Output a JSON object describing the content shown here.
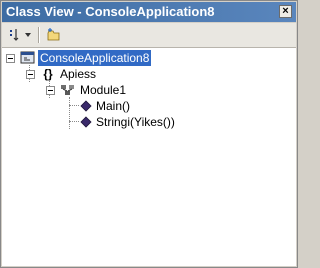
{
  "window": {
    "title": "Class View - ConsoleApplication8",
    "close_glyph": "×"
  },
  "toolbar": {
    "sort_button_icon": "sort-icon",
    "new_folder_icon": "new-folder-icon"
  },
  "tree": {
    "project": {
      "label": "ConsoleApplication8",
      "icon": "project-icon",
      "expanded": true,
      "selected": true
    },
    "namespace": {
      "label": "Apiess",
      "icon": "namespace-icon",
      "expanded": true
    },
    "module": {
      "label": "Module1",
      "icon": "module-icon",
      "expanded": true
    },
    "members": [
      {
        "label": "Main()",
        "icon": "method-icon"
      },
      {
        "label": "Stringi(Yikes())",
        "icon": "method-icon"
      }
    ]
  },
  "colors": {
    "titlebar": "#3d6ca3",
    "selection": "#316ac5"
  }
}
